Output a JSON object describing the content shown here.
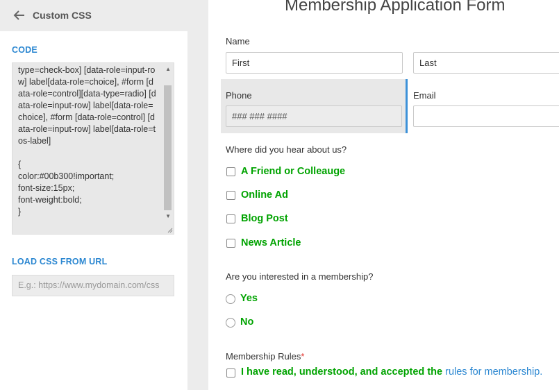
{
  "panel": {
    "title": "Custom CSS",
    "code_label": "CODE",
    "code_text": "type=check-box] [data-role=input-row] label[data-role=choice], #form [data-role=control][data-type=radio] [data-role=input-row] label[data-role=choice], #form [data-role=control] [data-role=input-row] label[data-role=tos-label]\n\n{\ncolor:#00b300!important;\nfont-size:15px;\nfont-weight:bold;\n}",
    "url_label": "LOAD CSS FROM URL",
    "url_placeholder": "E.g.: https://www.mydomain.com/css"
  },
  "form": {
    "title": "Membership Application Form",
    "name_label": "Name",
    "first_placeholder": "First",
    "last_placeholder": "Last",
    "phone_label": "Phone",
    "phone_placeholder": "### ### ####",
    "email_label": "Email",
    "hear_question": "Where did you hear about us?",
    "hear_options": [
      "A Friend or Colleauge",
      "Online Ad",
      "Blog Post",
      "News Article"
    ],
    "membership_question": "Are you interested in a membership?",
    "membership_options": [
      "Yes",
      "No"
    ],
    "rules_label": "Membership Rules",
    "rules_required": "*",
    "tos_text": "I have read, understood, and accepted the ",
    "tos_link": "rules for membership",
    "tos_end": "."
  },
  "colors": {
    "accent": "#2b87d1",
    "choice_green": "#00a300",
    "required_red": "#e2312b"
  },
  "icons": [
    "back-arrow-icon",
    "scroll-up-icon",
    "scroll-down-icon",
    "resize-grip-icon"
  ]
}
